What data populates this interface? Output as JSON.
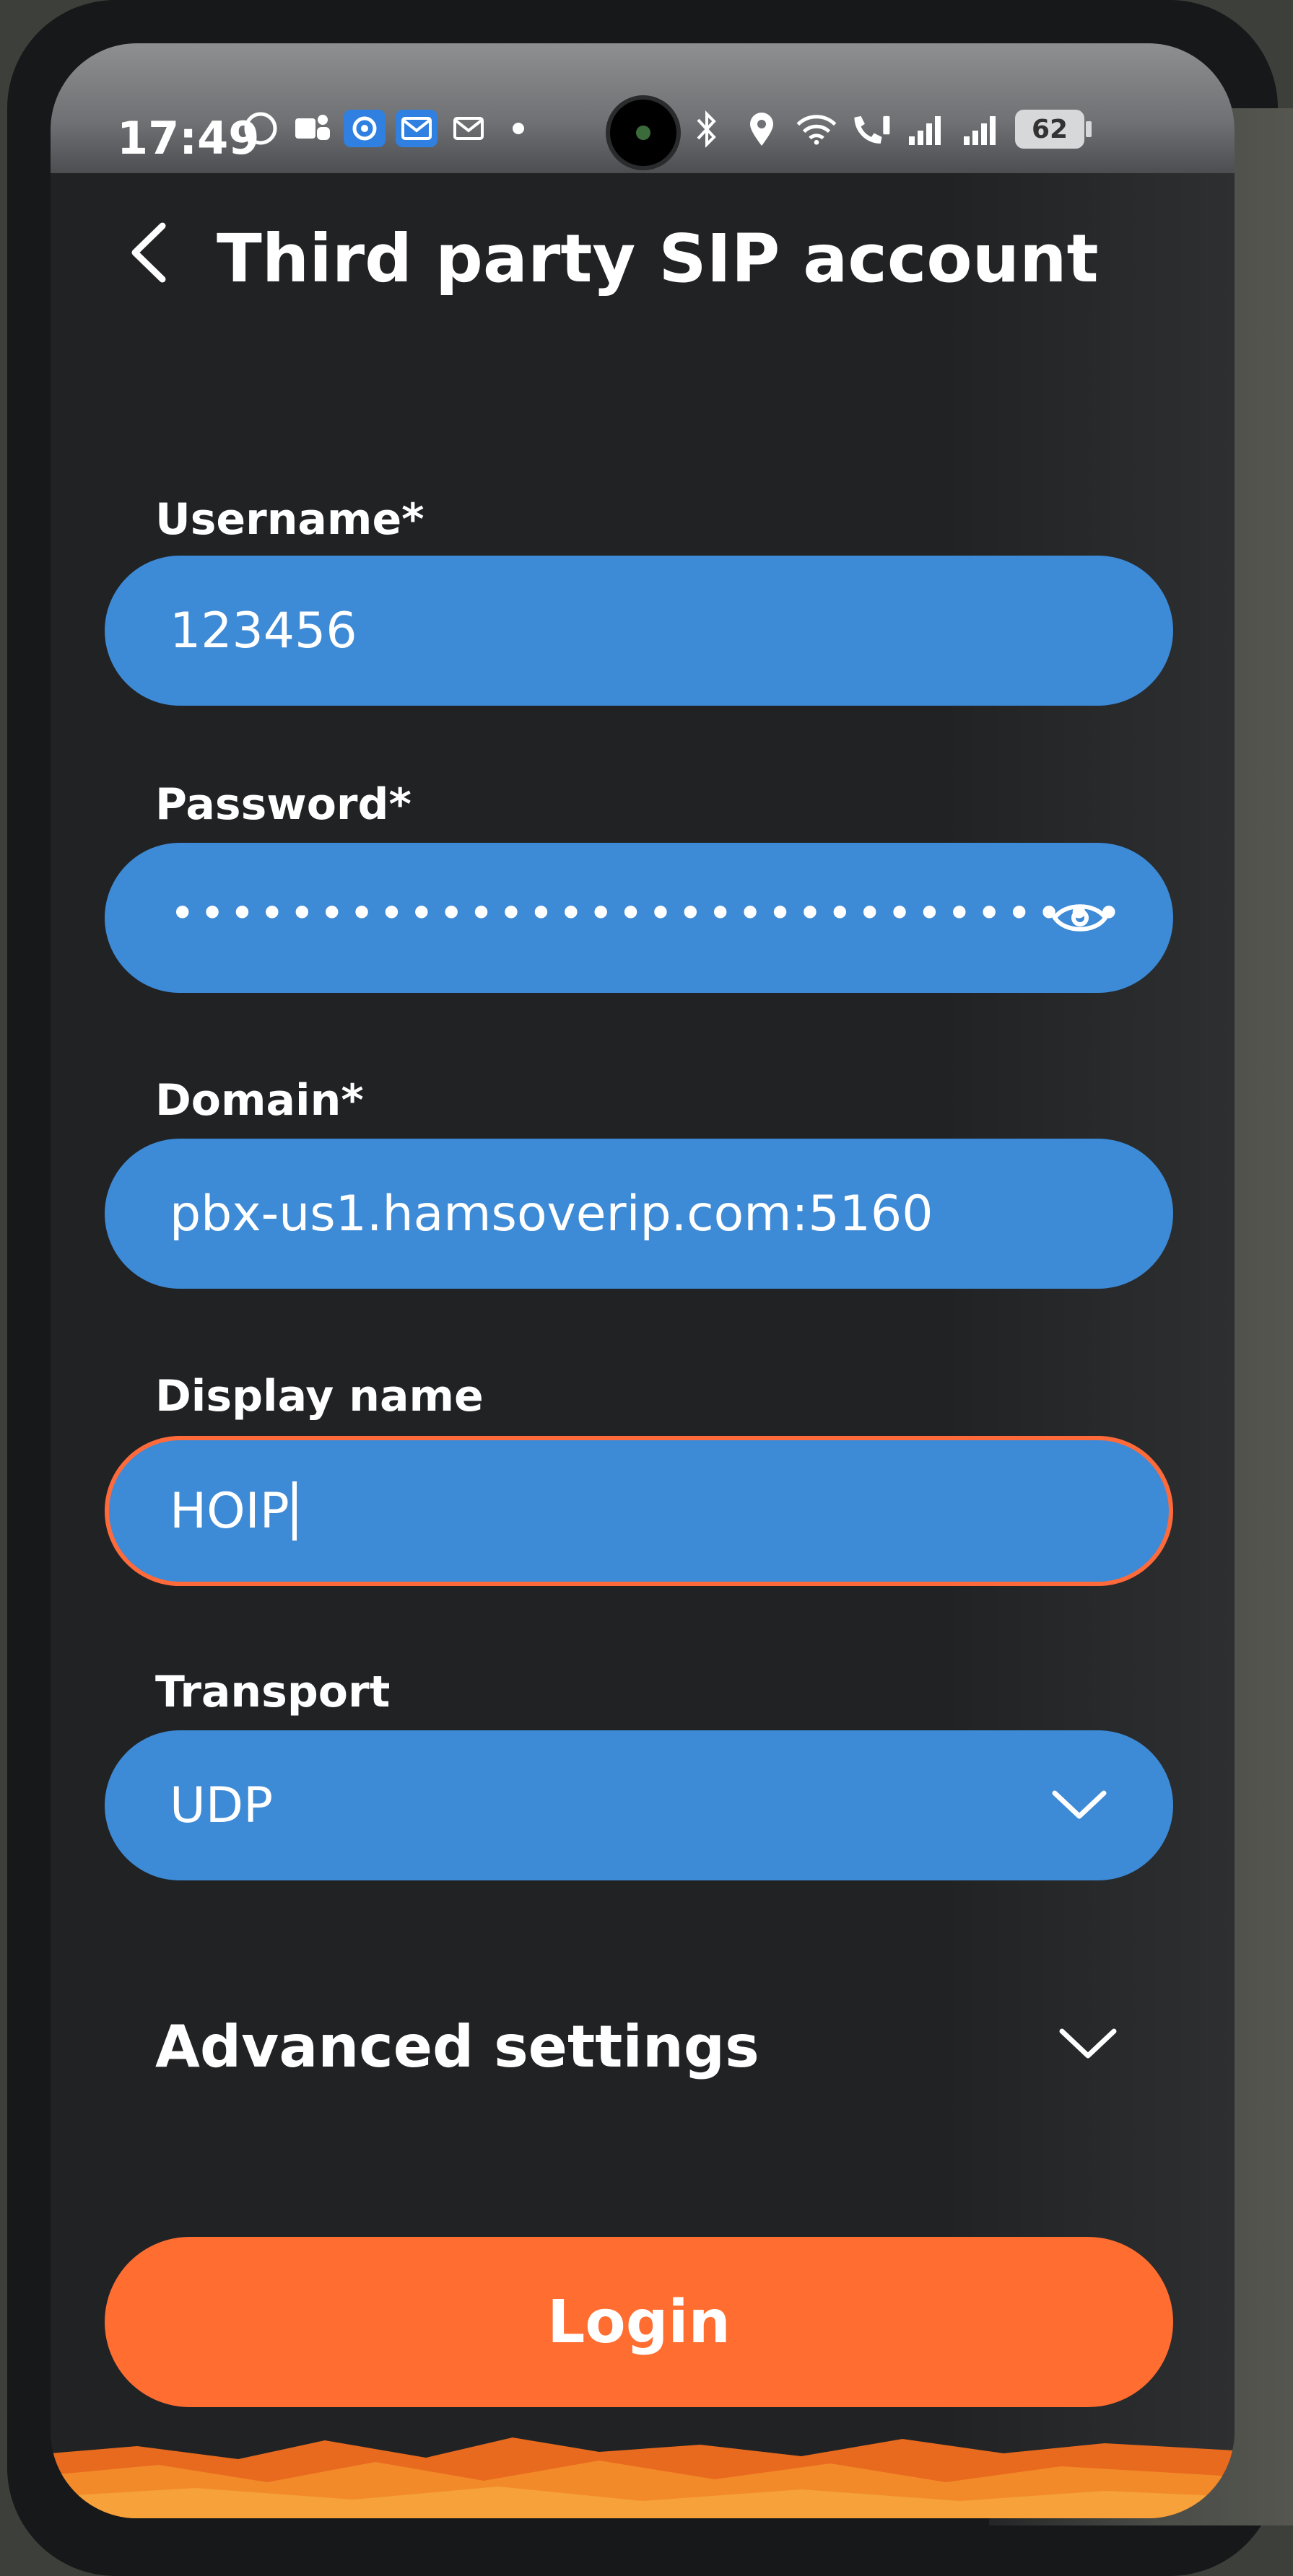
{
  "status_bar": {
    "time": "17:49",
    "left_icons": [
      "whatsapp-icon",
      "teams-icon",
      "app-icon",
      "email-icon",
      "mail-icon",
      "dot-icon"
    ],
    "right_icons": [
      "bluetooth-icon",
      "location-icon",
      "wifi-icon",
      "wifi-calling-icon",
      "signal-icon",
      "signal-icon"
    ],
    "battery": "62"
  },
  "header": {
    "title": "Third party SIP account"
  },
  "form": {
    "username": {
      "label": "Username*",
      "value": "123456"
    },
    "password": {
      "label": "Password*",
      "value": "••••••••••••••••••••••••••••••••"
    },
    "domain": {
      "label": "Domain*",
      "value": "pbx-us1.hamsoverip.com:5160"
    },
    "display_name": {
      "label": "Display name",
      "value": "HOIP"
    },
    "transport": {
      "label": "Transport",
      "value": "UDP"
    }
  },
  "advanced": {
    "label": "Advanced settings"
  },
  "login": {
    "label": "Login"
  },
  "colors": {
    "field_bg": "#3d8ad6",
    "focus_border": "#ff6a3b",
    "accent": "#ff6d31",
    "background": "#202224"
  }
}
